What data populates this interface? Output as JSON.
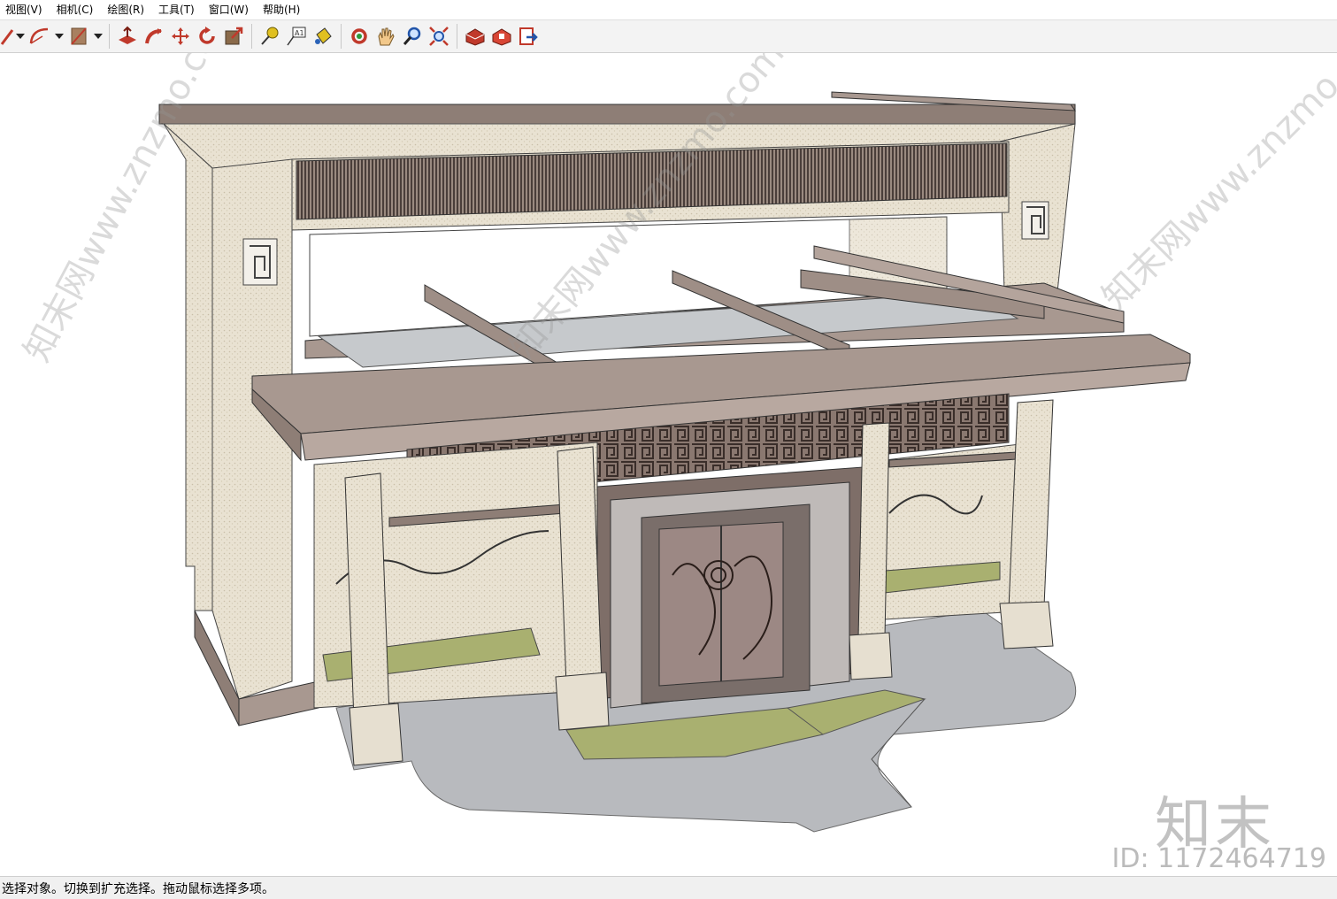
{
  "menu": [
    {
      "label": "视图(V)"
    },
    {
      "label": "相机(C)"
    },
    {
      "label": "绘图(R)"
    },
    {
      "label": "工具(T)"
    },
    {
      "label": "窗口(W)"
    },
    {
      "label": "帮助(H)"
    }
  ],
  "toolbar": {
    "tools": [
      {
        "icon": "pencil-icon",
        "color": "#c0392b",
        "has_dropdown": true
      },
      {
        "icon": "arc-icon",
        "color": "#c0392b",
        "has_dropdown": true
      },
      {
        "icon": "rectangle-icon",
        "color": "#8a6a3a",
        "has_dropdown": true
      },
      {
        "icon": "push-pull-icon",
        "color": "#c0392b"
      },
      {
        "icon": "follow-me-icon",
        "color": "#c0392b"
      },
      {
        "icon": "move-icon",
        "color": "#c0392b"
      },
      {
        "icon": "rotate-icon",
        "color": "#c0392b"
      },
      {
        "icon": "scale-icon",
        "color": "#c0392b"
      },
      {
        "icon": "tape-measure-icon",
        "color": "#c9a200"
      },
      {
        "icon": "text-icon",
        "color": "#333333"
      },
      {
        "icon": "paint-bucket-icon",
        "color": "#c9a200"
      },
      {
        "icon": "orbit-icon",
        "color": "#c0392b"
      },
      {
        "icon": "pan-icon",
        "color": "#d9a35a"
      },
      {
        "icon": "zoom-icon",
        "color": "#2255aa"
      },
      {
        "icon": "zoom-extents-icon",
        "color": "#c0392b"
      },
      {
        "icon": "warehouse-icon",
        "color": "#c0392b"
      },
      {
        "icon": "extension-warehouse-icon",
        "color": "#c0392b"
      },
      {
        "icon": "send-to-layout-icon",
        "color": "#c0392b"
      }
    ]
  },
  "viewport": {
    "watermark_brand": "知末",
    "watermark_id": "ID: 1172464719",
    "diagonal_watermark": "知末网www.znzmo.com"
  },
  "status": {
    "text": "选择对象。切换到扩充选择。拖动鼠标选择多项。"
  }
}
